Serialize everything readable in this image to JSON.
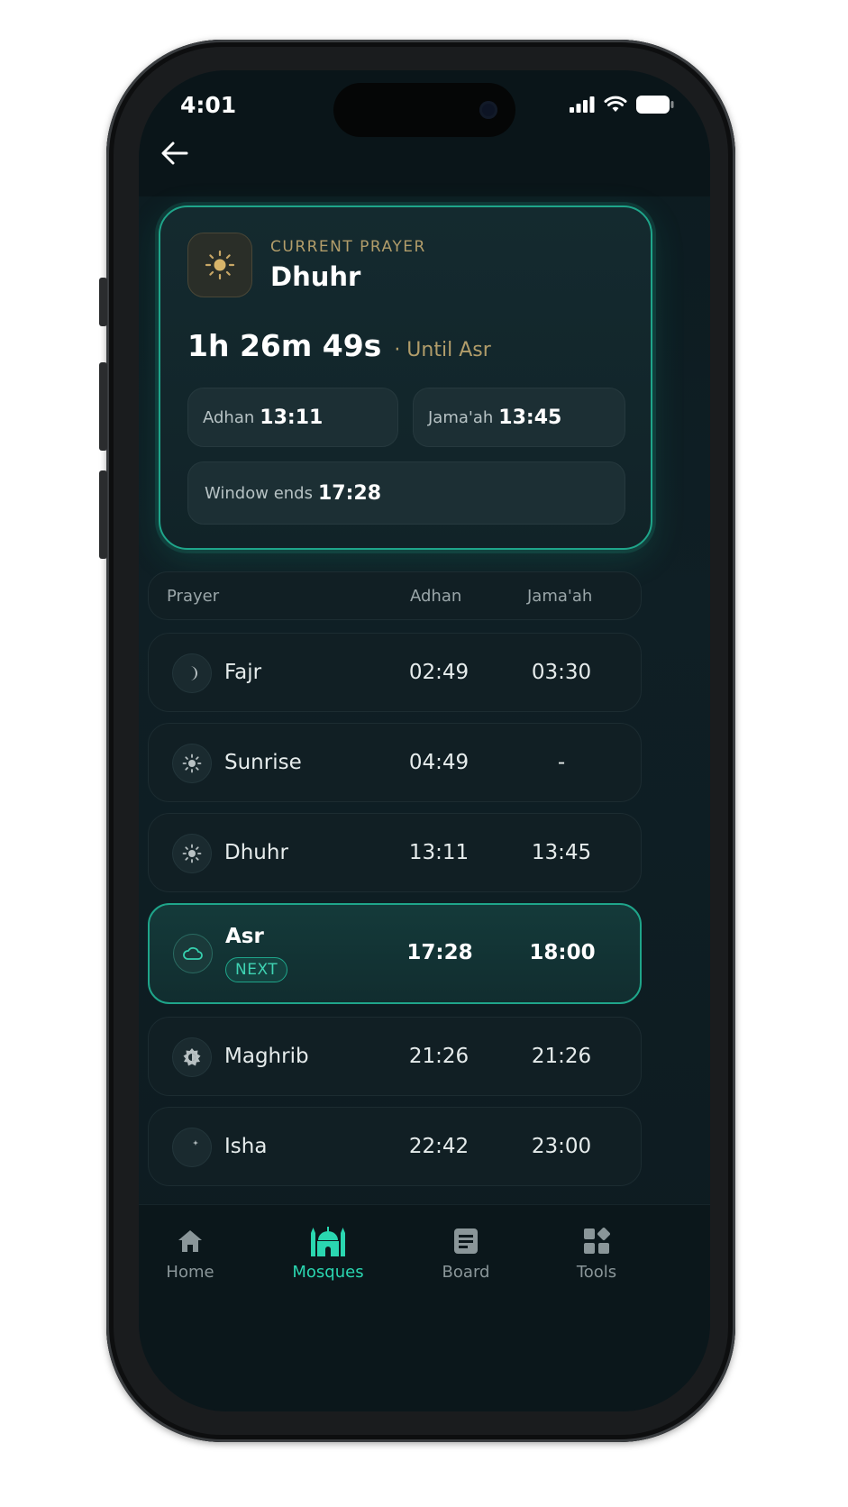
{
  "status": {
    "time": "4:01"
  },
  "current": {
    "label": "CURRENT PRAYER",
    "name": "Dhuhr",
    "countdown": "1h 26m 49s",
    "until": "· Until Asr",
    "adhan_label": "Adhan",
    "adhan_time": "13:11",
    "jamaah_label": "Jama'ah",
    "jamaah_time": "13:45",
    "window_label": "Window ends",
    "window_time": "17:28"
  },
  "table": {
    "headers": {
      "prayer": "Prayer",
      "adhan": "Adhan",
      "jamaah": "Jama'ah"
    },
    "rows": [
      {
        "name": "Fajr",
        "adhan": "02:49",
        "jamaah": "03:30",
        "icon": "moon-icon"
      },
      {
        "name": "Sunrise",
        "adhan": "04:49",
        "jamaah": "-",
        "icon": "sun-icon"
      },
      {
        "name": "Dhuhr",
        "adhan": "13:11",
        "jamaah": "13:45",
        "icon": "sun-icon"
      },
      {
        "name": "Asr",
        "adhan": "17:28",
        "jamaah": "18:00",
        "icon": "cloud-icon",
        "badge": "NEXT"
      },
      {
        "name": "Maghrib",
        "adhan": "21:26",
        "jamaah": "21:26",
        "icon": "sunset-icon"
      },
      {
        "name": "Isha",
        "adhan": "22:42",
        "jamaah": "23:00",
        "icon": "moon-stars-icon"
      }
    ]
  },
  "nav": {
    "home": "Home",
    "mosques": "Mosques",
    "board": "Board",
    "tools": "Tools"
  },
  "colors": {
    "accent": "#1fa58a",
    "gold": "#b29d6a",
    "background": "#0f1f25"
  }
}
